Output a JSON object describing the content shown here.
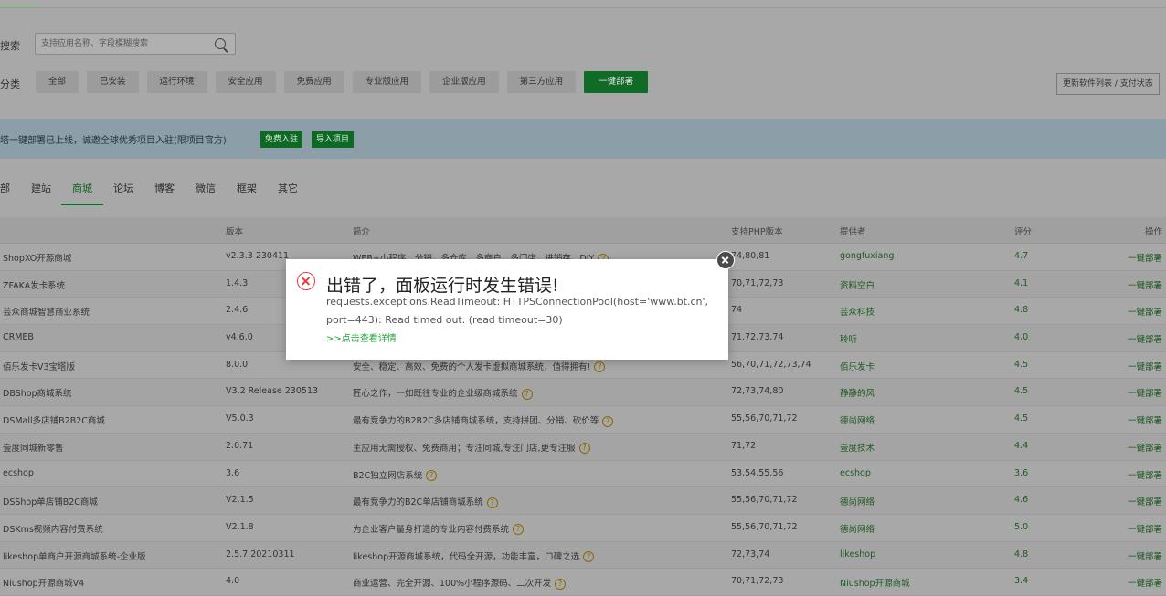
{
  "search": {
    "label": "搜索",
    "placeholder": "支持应用名称、字段模糊搜索"
  },
  "category": {
    "label": "分类",
    "buttons": [
      "全部",
      "已安装",
      "运行环境",
      "安全应用",
      "免费应用",
      "专业版应用",
      "企业版应用",
      "第三方应用",
      "一键部署"
    ],
    "active_index": 8
  },
  "update_button": "更新软件列表 / 支付状态",
  "banner": {
    "text": "塔一键部署已上线，诚邀全球优秀项目入驻(限项目官方)",
    "apply_button": "免费入驻",
    "import_button": "导入项目"
  },
  "tabs": {
    "items": [
      "部",
      "建站",
      "商城",
      "论坛",
      "博客",
      "微信",
      "框架",
      "其它"
    ],
    "active_index": 2
  },
  "table": {
    "headers": {
      "version": "版本",
      "desc": "简介",
      "php": "支持PHP版本",
      "provider": "提供者",
      "score": "评分",
      "action": "操作"
    },
    "rows": [
      {
        "name": "ShopXO开源商城",
        "version": "v2.3.3 230411",
        "desc": "WEB+小程序，分销，多仓库，多商户，多门店，进销存，DIY",
        "php": "74,80,81",
        "provider": "gongfuxiang",
        "score": "4.7",
        "action": "一键部署"
      },
      {
        "name": "ZFAKA发卡系统",
        "version": "1.4.3",
        "desc": "",
        "php": "70,71,72,73",
        "provider": "资料空白",
        "score": "4.1",
        "action": "一键部署"
      },
      {
        "name": "芸众商城智慧商业系统",
        "version": "2.4.6",
        "desc": "",
        "php": "74",
        "provider": "芸众科技",
        "score": "4.8",
        "action": "一键部署"
      },
      {
        "name": "CRMEB",
        "version": "v4.6.0",
        "desc": "",
        "php": "71,72,73,74",
        "provider": "聆听",
        "score": "4.0",
        "action": "一键部署"
      },
      {
        "name": "佰乐发卡V3宝塔版",
        "version": "8.0.0",
        "desc": "安全、稳定、高效、免费的个人发卡虚拟商城系统，值得拥有!",
        "php": "56,70,71,72,73,74",
        "provider": "佰乐发卡",
        "score": "4.5",
        "action": "一键部署"
      },
      {
        "name": "DBShop商城系统",
        "version": "V3.2 Release 230513",
        "desc": "匠心之作，一如既往专业的企业级商城系统",
        "php": "72,73,74,80",
        "provider": "静静的风",
        "score": "4.5",
        "action": "一键部署"
      },
      {
        "name": "DSMall多店铺B2B2C商城",
        "version": "V5.0.3",
        "desc": "最有竞争力的B2B2C多店铺商城系统，支持拼团、分销、砍价等",
        "php": "55,56,70,71,72",
        "provider": "德尚网络",
        "score": "4.5",
        "action": "一键部署"
      },
      {
        "name": "壹度同城新零售",
        "version": "2.0.71",
        "desc": "主应用无需授权、免费商用；专注同城,专注门店,更专注服",
        "php": "71,72",
        "provider": "壹度技术",
        "score": "4.4",
        "action": "一键部署"
      },
      {
        "name": "ecshop",
        "version": "3.6",
        "desc": "B2C独立网店系统",
        "php": "53,54,55,56",
        "provider": "ecshop",
        "score": "3.6",
        "action": "一键部署"
      },
      {
        "name": "DSShop单店铺B2C商城",
        "version": "V2.1.5",
        "desc": "最有竞争力的B2C单店铺商城系统",
        "php": "55,56,70,71,72",
        "provider": "德尚网络",
        "score": "4.6",
        "action": "一键部署"
      },
      {
        "name": "DSKms视频内容付费系统",
        "version": "V2.1.8",
        "desc": "为企业客户量身打造的专业内容付费系统",
        "php": "55,56,70,71,72",
        "provider": "德尚网络",
        "score": "5.0",
        "action": "一键部署"
      },
      {
        "name": "likeshop单商户开源商城系统-企业版",
        "version": "2.5.7.20210311",
        "desc": "likeshop开源商城系统，代码全开源，功能丰富，口碑之选",
        "php": "72,73,74",
        "provider": "likeshop",
        "score": "4.8",
        "action": "一键部署"
      },
      {
        "name": "Niushop开源商城V4",
        "version": "4.0",
        "desc": "商业运营、完全开源、100%小程序源码、二次开发",
        "php": "70,71,72,73",
        "provider": "Niushop开源商城",
        "score": "3.4",
        "action": "一键部署"
      }
    ]
  },
  "modal": {
    "title": "出错了，面板运行时发生错误!",
    "message": "requests.exceptions.ReadTimeout: HTTPSConnectionPool(host='www.bt.cn', port=443): Read timed out. (read timeout=30)",
    "link": ">>点击查看详情"
  }
}
